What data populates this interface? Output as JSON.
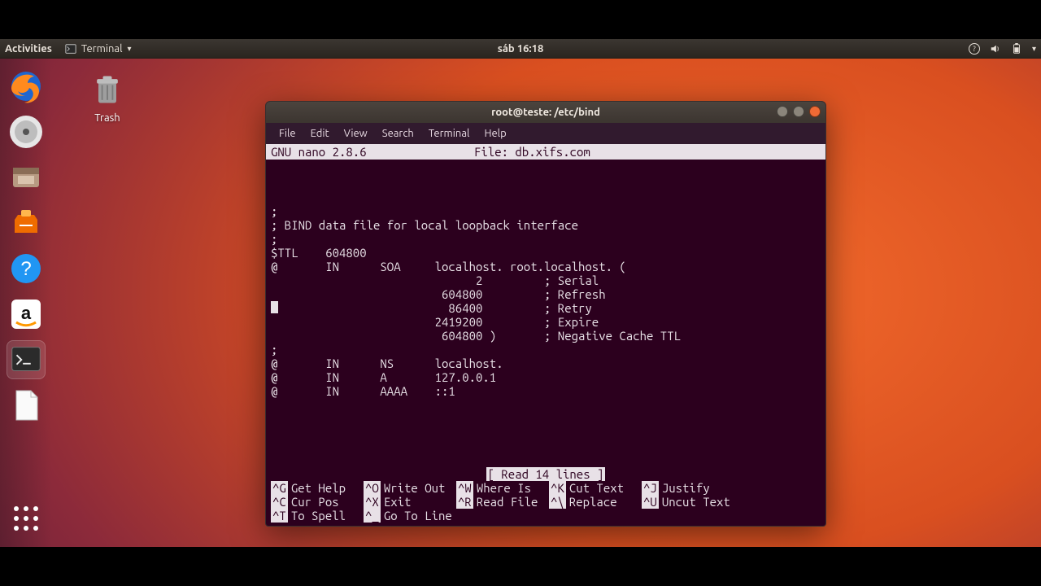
{
  "topbar": {
    "activities": "Activities",
    "terminal_label": "Terminal",
    "clock": "sáb 16:18"
  },
  "dock": {
    "items": [
      {
        "name": "firefox"
      },
      {
        "name": "rhythmbox"
      },
      {
        "name": "files"
      },
      {
        "name": "software"
      },
      {
        "name": "help"
      },
      {
        "name": "amazon"
      },
      {
        "name": "terminal",
        "active": true
      },
      {
        "name": "libreoffice"
      }
    ]
  },
  "desktop": {
    "trash_label": "Trash"
  },
  "window": {
    "title": "root@teste: /etc/bind",
    "menus": [
      "File",
      "Edit",
      "View",
      "Search",
      "Terminal",
      "Help"
    ],
    "nano": {
      "version_label": "GNU nano 2.8.6",
      "file_label": "File: db.xifs.com",
      "body": ";\n; BIND data file for local loopback interface\n;\n$TTL    604800\n@       IN      SOA     localhost. root.localhost. (\n                              2         ; Serial\n                         604800         ; Refresh\n                          86400         ; Retry\n                        2419200         ; Expire\n                         604800 )       ; Negative Cache TTL\n;\n@       IN      NS      localhost.\n@       IN      A       127.0.0.1\n@       IN      AAAA    ::1",
      "status": "[ Read 14 lines ]",
      "help": [
        {
          "k": "^G",
          "v": "Get Help"
        },
        {
          "k": "^O",
          "v": "Write Out"
        },
        {
          "k": "^W",
          "v": "Where Is"
        },
        {
          "k": "^K",
          "v": "Cut Text"
        },
        {
          "k": "^J",
          "v": "Justify"
        },
        {
          "k": "^C",
          "v": "Cur Pos"
        },
        {
          "k": "^X",
          "v": "Exit"
        },
        {
          "k": "^R",
          "v": "Read File"
        },
        {
          "k": "^\\",
          "v": "Replace"
        },
        {
          "k": "^U",
          "v": "Uncut Text"
        },
        {
          "k": "^T",
          "v": "To Spell"
        },
        {
          "k": "^_",
          "v": "Go To Line"
        }
      ]
    }
  }
}
